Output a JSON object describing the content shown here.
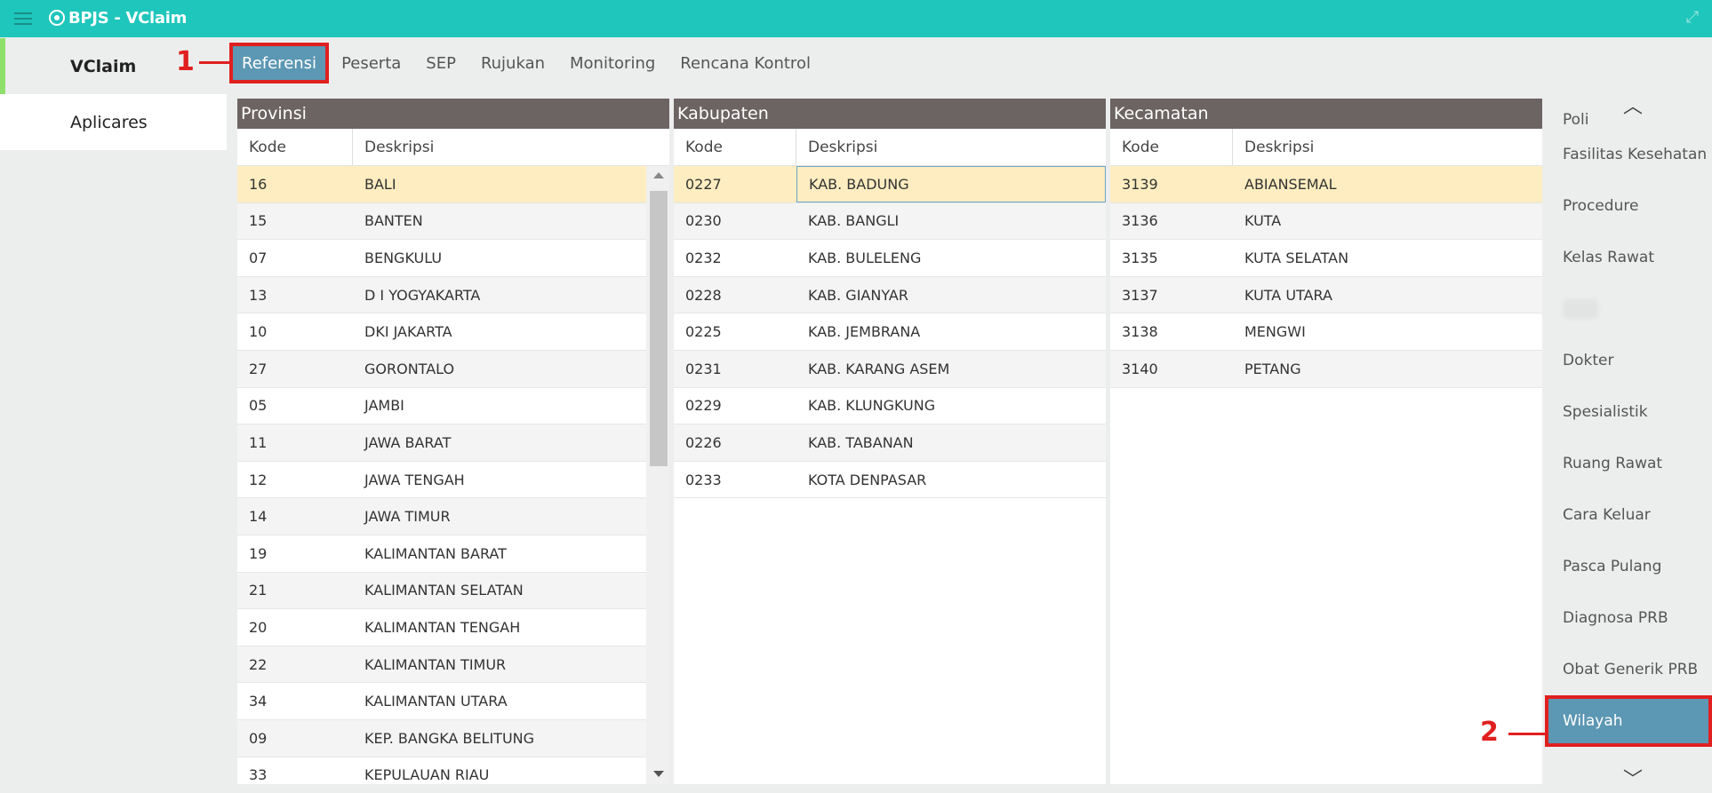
{
  "app": {
    "title": "BPJS - VClaim"
  },
  "sidebar": {
    "items": [
      {
        "label": "VClaim"
      },
      {
        "label": "Aplicares"
      }
    ]
  },
  "tabs": [
    {
      "label": "Referensi"
    },
    {
      "label": "Peserta"
    },
    {
      "label": "SEP"
    },
    {
      "label": "Rujukan"
    },
    {
      "label": "Monitoring"
    },
    {
      "label": "Rencana Kontrol"
    }
  ],
  "annotations": {
    "first": "1",
    "second": "2"
  },
  "provinsi": {
    "title": "Provinsi",
    "col_kode": "Kode",
    "col_desc": "Deskripsi",
    "rows": [
      {
        "kode": "16",
        "desc": "BALI"
      },
      {
        "kode": "15",
        "desc": "BANTEN"
      },
      {
        "kode": "07",
        "desc": "BENGKULU"
      },
      {
        "kode": "13",
        "desc": "D I YOGYAKARTA"
      },
      {
        "kode": "10",
        "desc": "DKI JAKARTA"
      },
      {
        "kode": "27",
        "desc": "GORONTALO"
      },
      {
        "kode": "05",
        "desc": "JAMBI"
      },
      {
        "kode": "11",
        "desc": "JAWA BARAT"
      },
      {
        "kode": "12",
        "desc": "JAWA TENGAH"
      },
      {
        "kode": "14",
        "desc": "JAWA TIMUR"
      },
      {
        "kode": "19",
        "desc": "KALIMANTAN BARAT"
      },
      {
        "kode": "21",
        "desc": "KALIMANTAN SELATAN"
      },
      {
        "kode": "20",
        "desc": "KALIMANTAN TENGAH"
      },
      {
        "kode": "22",
        "desc": "KALIMANTAN TIMUR"
      },
      {
        "kode": "34",
        "desc": "KALIMANTAN UTARA"
      },
      {
        "kode": "09",
        "desc": "KEP. BANGKA BELITUNG"
      },
      {
        "kode": "33",
        "desc": "KEPULAUAN RIAU"
      }
    ]
  },
  "kabupaten": {
    "title": "Kabupaten",
    "col_kode": "Kode",
    "col_desc": "Deskripsi",
    "rows": [
      {
        "kode": "0227",
        "desc": "KAB. BADUNG"
      },
      {
        "kode": "0230",
        "desc": "KAB. BANGLI"
      },
      {
        "kode": "0232",
        "desc": "KAB. BULELENG"
      },
      {
        "kode": "0228",
        "desc": "KAB. GIANYAR"
      },
      {
        "kode": "0225",
        "desc": "KAB. JEMBRANA"
      },
      {
        "kode": "0231",
        "desc": "KAB. KARANG ASEM"
      },
      {
        "kode": "0229",
        "desc": "KAB. KLUNGKUNG"
      },
      {
        "kode": "0226",
        "desc": "KAB. TABANAN"
      },
      {
        "kode": "0233",
        "desc": "KOTA DENPASAR"
      }
    ]
  },
  "kecamatan": {
    "title": "Kecamatan",
    "col_kode": "Kode",
    "col_desc": "Deskripsi",
    "rows": [
      {
        "kode": "3139",
        "desc": "ABIANSEMAL"
      },
      {
        "kode": "3136",
        "desc": "KUTA"
      },
      {
        "kode": "3135",
        "desc": "KUTA SELATAN"
      },
      {
        "kode": "3137",
        "desc": "KUTA UTARA"
      },
      {
        "kode": "3138",
        "desc": "MENGWI"
      },
      {
        "kode": "3140",
        "desc": "PETANG"
      }
    ]
  },
  "rightnav": {
    "items": [
      {
        "label": "Poli"
      },
      {
        "label": "Fasilitas Kesehatan"
      },
      {
        "label": "Procedure"
      },
      {
        "label": "Kelas Rawat"
      },
      {
        "label": ""
      },
      {
        "label": "Dokter"
      },
      {
        "label": "Spesialistik"
      },
      {
        "label": "Ruang Rawat"
      },
      {
        "label": "Cara Keluar"
      },
      {
        "label": "Pasca Pulang"
      },
      {
        "label": "Diagnosa PRB"
      },
      {
        "label": "Obat Generik PRB"
      },
      {
        "label": "Wilayah"
      }
    ]
  }
}
